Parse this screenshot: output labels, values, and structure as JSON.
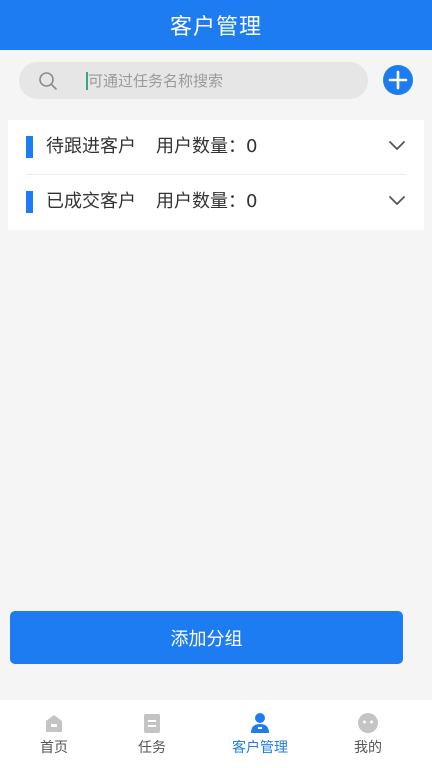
{
  "header": {
    "title": "客户管理"
  },
  "search": {
    "placeholder": "可通过任务名称搜索"
  },
  "groups": [
    {
      "name": "待跟进客户",
      "count_text": "用户数量：0"
    },
    {
      "name": "已成交客户",
      "count_text": "用户数量：0"
    }
  ],
  "add_group_label": "添加分组",
  "tabbar": {
    "items": [
      {
        "label": "首页",
        "icon": "home-icon"
      },
      {
        "label": "任务",
        "icon": "task-icon"
      },
      {
        "label": "客户管理",
        "icon": "user-icon",
        "active": true
      },
      {
        "label": "我的",
        "icon": "profile-icon"
      }
    ]
  },
  "colors": {
    "primary": "#1e7cf2",
    "background": "#f5f5f5",
    "tab_inactive_icon": "#c4c4c4"
  }
}
